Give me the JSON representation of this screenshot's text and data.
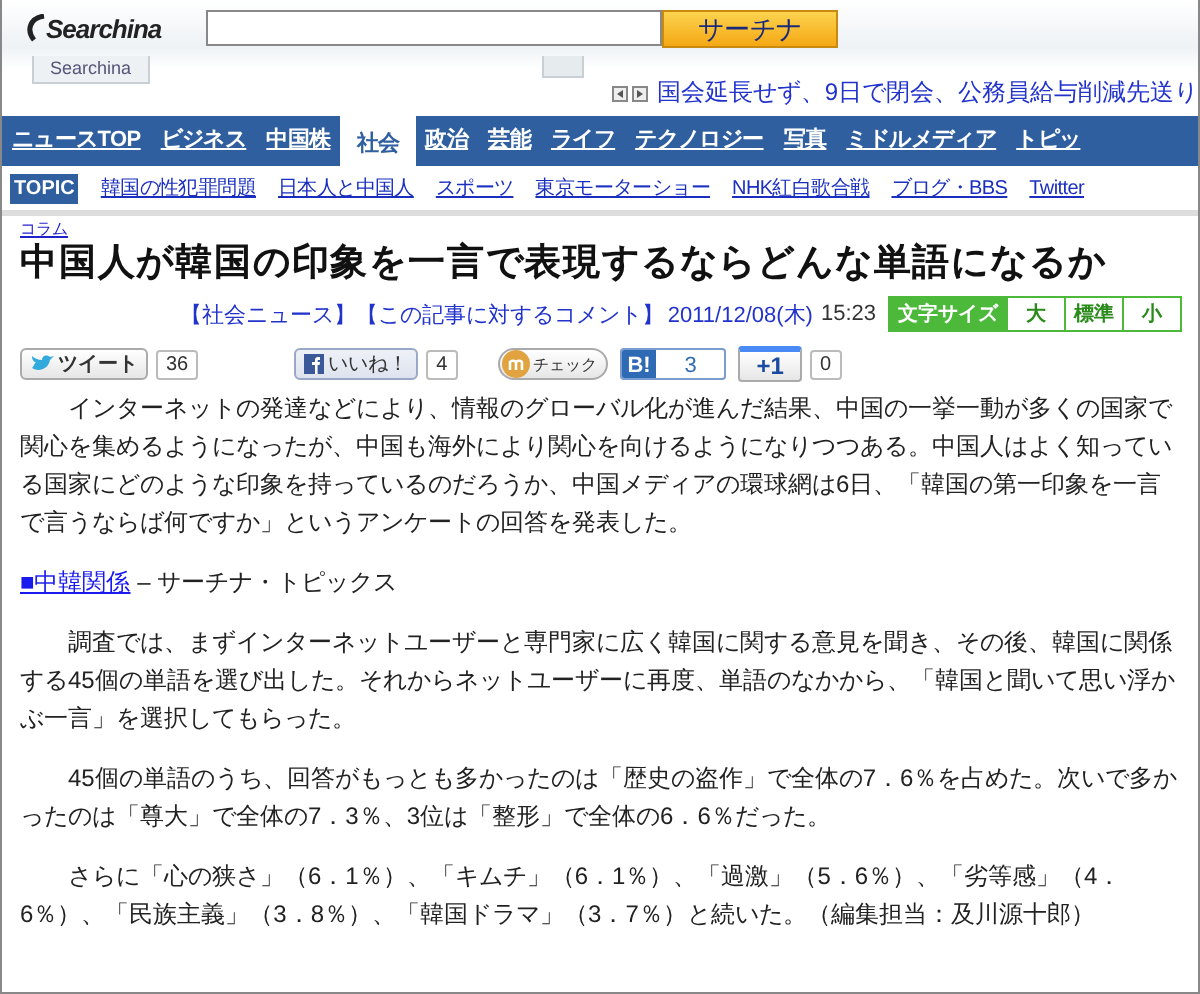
{
  "header": {
    "logo": "Searchina",
    "search_button": "サーチナ",
    "logo_tab": "Searchina",
    "ticker": "国会延長せず、9日で閉会、公務員給与削減先送り"
  },
  "nav": [
    {
      "label": "ニュースTOP",
      "selected": false
    },
    {
      "label": "ビジネス",
      "selected": false
    },
    {
      "label": "中国株",
      "selected": false
    },
    {
      "label": "社会",
      "selected": true
    },
    {
      "label": "政治",
      "selected": false
    },
    {
      "label": "芸能",
      "selected": false
    },
    {
      "label": "ライフ",
      "selected": false
    },
    {
      "label": "テクノロジー",
      "selected": false
    },
    {
      "label": "写真",
      "selected": false
    },
    {
      "label": "ミドルメディア",
      "selected": false
    },
    {
      "label": "トピッ",
      "selected": false
    }
  ],
  "topics": {
    "label": "TOPIC",
    "links": [
      "韓国の性犯罪問題",
      "日本人と中国人",
      "スポーツ",
      "東京モーターショー",
      "NHK紅白歌合戦",
      "ブログ・BBS",
      "Twitter"
    ]
  },
  "article": {
    "category": "コラム",
    "title": "中国人が韓国の印象を一言で表現するならどんな単語になるか",
    "meta": {
      "links": [
        "【社会ニュース】",
        "【この記事に対するコメント】"
      ],
      "date": "2011/12/08(木)",
      "time": "15:23"
    },
    "font_size": {
      "label": "文字サイズ",
      "options": [
        "大",
        "標準",
        "小"
      ]
    },
    "social": [
      {
        "kind": "tweet",
        "label": "ツイート",
        "count": "36"
      },
      {
        "kind": "like",
        "label": "いいね！",
        "count": "4"
      },
      {
        "kind": "check",
        "label": "チェック"
      },
      {
        "kind": "hatena",
        "label": "B!",
        "count": "3"
      },
      {
        "kind": "plusone",
        "label": "+1",
        "count": "0"
      }
    ],
    "body": [
      {
        "kind": "paragraph",
        "text": "インターネットの発達などにより、情報のグローバル化が進んだ結果、中国の一挙一動が多くの国家で関心を集めるようになったが、中国も海外により関心を向けるようになりつつある。中国人はよく知っている国家にどのような印象を持っているのだろうか、中国メディアの環球網は6日、「韓国の第一印象を一言で言うならば何ですか」というアンケートの回答を発表した。"
      },
      {
        "kind": "related",
        "link": "■中韓関係",
        "text": "– サーチナ・トピックス"
      },
      {
        "kind": "paragraph",
        "text": "調査では、まずインターネットユーザーと専門家に広く韓国に関する意見を聞き、その後、韓国に関係する45個の単語を選び出した。それからネットユーザーに再度、単語のなかから、「韓国と聞いて思い浮かぶ一言」を選択してもらった。"
      },
      {
        "kind": "paragraph",
        "text": "45個の単語のうち、回答がもっとも多かったのは「歴史の盗作」で全体の7．6％を占めた。次いで多かったのは「尊大」で全体の7．3％、3位は「整形」で全体の6．6％だった。"
      },
      {
        "kind": "paragraph",
        "text": "さらに「心の狭さ」（6．1％）、「キムチ」（6．1％）、「過激」（5．6％）、「劣等感」（4．6％）、「民族主義」（3．8％）、「韓国ドラマ」（3．7％）と続いた。（編集担当：及川源十郎）"
      }
    ]
  }
}
